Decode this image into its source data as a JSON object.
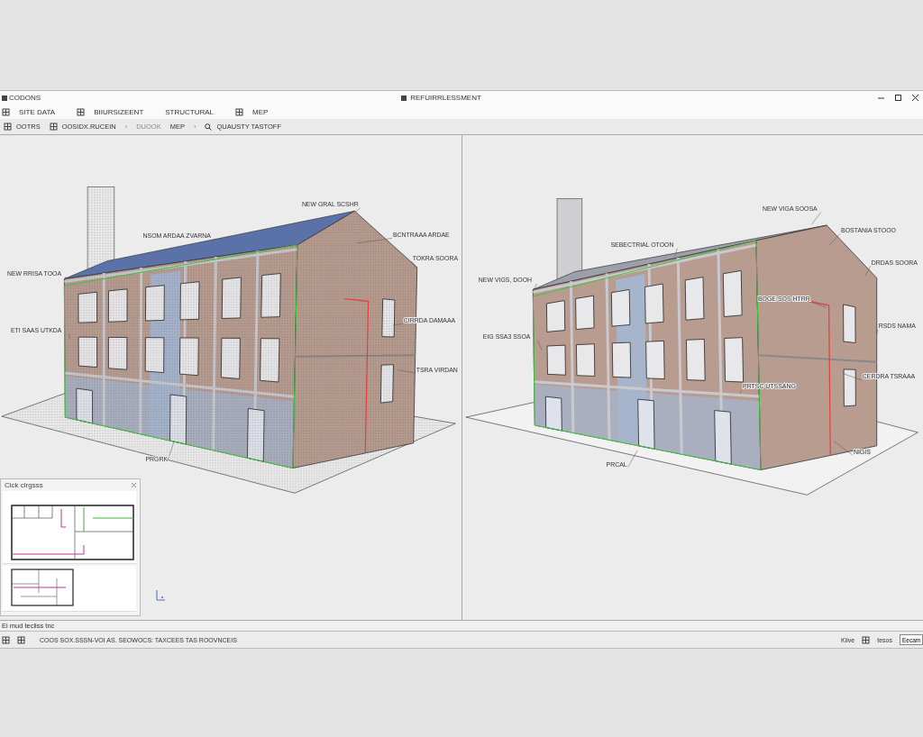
{
  "window": {
    "app_label": "CODONS",
    "title": "REFUIRRLESSMENT"
  },
  "menu": [
    {
      "label": "SITE DATA",
      "has_icon": true
    },
    {
      "label": "BIIURSIZEENT",
      "has_icon": true
    },
    {
      "label": "STRUCTURAL",
      "has_icon": false
    },
    {
      "label": "MEP",
      "has_icon": true
    }
  ],
  "toolbar": [
    {
      "kind": "button",
      "label": "OOTRS",
      "disabled": false
    },
    {
      "kind": "button",
      "label": "OOSIDX.RUCEIN",
      "disabled": false
    },
    {
      "kind": "separator",
      "label": "›"
    },
    {
      "kind": "button",
      "label": "DUOOK",
      "disabled": true
    },
    {
      "kind": "button",
      "label": "MEP",
      "disabled": false
    },
    {
      "kind": "separator",
      "label": "›"
    },
    {
      "kind": "search",
      "label": "QUAUSTY TASTOFF",
      "disabled": false
    }
  ],
  "viewports": [
    {
      "kind": "stippled",
      "annotations": [
        {
          "text": "NEW GRAL SCSHR"
        },
        {
          "text": "NSOM ARDAA ZVARNA"
        },
        {
          "text": "BCNTRAAA ARDAE"
        },
        {
          "text": "TOKRA SOORA"
        },
        {
          "text": "NEW RRISA TOOA"
        },
        {
          "text": "ETI SAAS UTKDA"
        },
        {
          "text": "CIRRDA DAMAAA"
        },
        {
          "text": "TSRA VIRDAN"
        },
        {
          "text": "PRGRK"
        }
      ]
    },
    {
      "kind": "shaded",
      "annotations": [
        {
          "text": "NEW VIGA SOOSA"
        },
        {
          "text": "BOSTANIA STOOO"
        },
        {
          "text": "SEBECTRIAL OTOON"
        },
        {
          "text": "DRDAS SOORA"
        },
        {
          "text": "NEW VIGS, DOOH"
        },
        {
          "text": "BOGE SOS HTRR"
        },
        {
          "text": "RSDS NAMA"
        },
        {
          "text": "EIG SSA3 SSOA"
        },
        {
          "text": "CERDRA TSRAAA"
        },
        {
          "text": "PRTSC UTSSANG"
        },
        {
          "text": "PRCAL"
        },
        {
          "text": "NIGIS"
        }
      ]
    }
  ],
  "inset_panel": {
    "title": "Cick clrgsss"
  },
  "status_line": "Ei mud tecliss tnc",
  "bottom_bar": {
    "message": "COOS SOX.SSSN-VOI AS. SEOWOCS: TAXCEES TAS ROOVNCEIS",
    "mode": "Kiive",
    "units": "tesos",
    "field_value": "Eecam"
  }
}
